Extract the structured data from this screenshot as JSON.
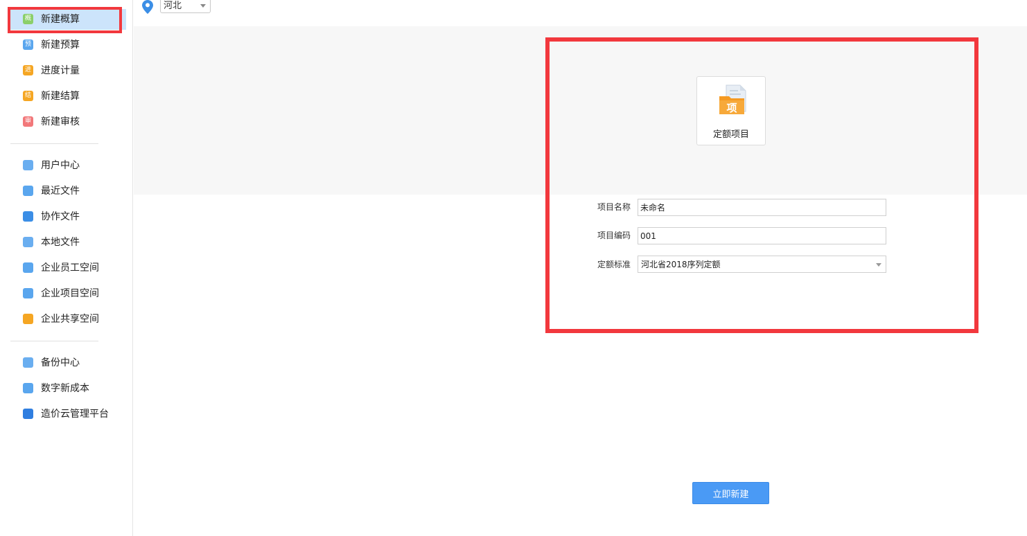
{
  "sidebar": {
    "groups": [
      [
        {
          "label": "新建概算",
          "icon": "概",
          "color": "#8bcf6a",
          "name": "sidebar-item-new-estimate",
          "icon_name": "estimate-icon",
          "active": true
        },
        {
          "label": "新建预算",
          "icon": "预",
          "color": "#5aa6ee",
          "name": "sidebar-item-new-budget",
          "icon_name": "budget-icon"
        },
        {
          "label": "进度计量",
          "icon": "进",
          "color": "#f5a623",
          "name": "sidebar-item-progress-measure",
          "icon_name": "progress-icon"
        },
        {
          "label": "新建结算",
          "icon": "结",
          "color": "#f5a623",
          "name": "sidebar-item-new-settlement",
          "icon_name": "settlement-icon"
        },
        {
          "label": "新建审核",
          "icon": "审",
          "color": "#f2787a",
          "name": "sidebar-item-new-audit",
          "icon_name": "audit-icon"
        }
      ],
      [
        {
          "label": "用户中心",
          "icon": "",
          "color": "#6aaef0",
          "name": "sidebar-item-user-center",
          "icon_name": "user-icon"
        },
        {
          "label": "最近文件",
          "icon": "",
          "color": "#5aa6ee",
          "name": "sidebar-item-recent-files",
          "icon_name": "recent-file-icon"
        },
        {
          "label": "协作文件",
          "icon": "",
          "color": "#3b8ee6",
          "name": "sidebar-item-collab-files",
          "icon_name": "collaboration-icon"
        },
        {
          "label": "本地文件",
          "icon": "",
          "color": "#6aaef0",
          "name": "sidebar-item-local-files",
          "icon_name": "local-file-icon"
        },
        {
          "label": "企业员工空间",
          "icon": "",
          "color": "#5aa6ee",
          "name": "sidebar-item-staff-space",
          "icon_name": "building-icon"
        },
        {
          "label": "企业项目空间",
          "icon": "",
          "color": "#5aa6ee",
          "name": "sidebar-item-project-space",
          "icon_name": "layers-icon"
        },
        {
          "label": "企业共享空间",
          "icon": "",
          "color": "#f5a623",
          "name": "sidebar-item-shared-space",
          "icon_name": "share-icon"
        }
      ],
      [
        {
          "label": "备份中心",
          "icon": "",
          "color": "#6aaef0",
          "name": "sidebar-item-backup-center",
          "icon_name": "backup-icon"
        },
        {
          "label": "数字新成本",
          "icon": "",
          "color": "#5aa6ee",
          "name": "sidebar-item-digital-cost",
          "icon_name": "digital-cost-icon"
        },
        {
          "label": "造价云管理平台",
          "icon": "",
          "color": "#2f7ee0",
          "name": "sidebar-item-cost-cloud",
          "icon_name": "cloud-icon"
        }
      ]
    ]
  },
  "topbar": {
    "region": "河北"
  },
  "template_card": {
    "label": "定额项目",
    "icon_text": "项"
  },
  "form": {
    "name_label": "项目名称",
    "name_value": "未命名",
    "code_label": "项目编码",
    "code_value": "001",
    "standard_label": "定额标准",
    "standard_value": "河北省2018序列定额"
  },
  "actions": {
    "create_label": "立即新建"
  },
  "colors": {
    "accent": "#4a9af5",
    "highlight": "#f2383d",
    "active_bg": "#cce4fb"
  }
}
